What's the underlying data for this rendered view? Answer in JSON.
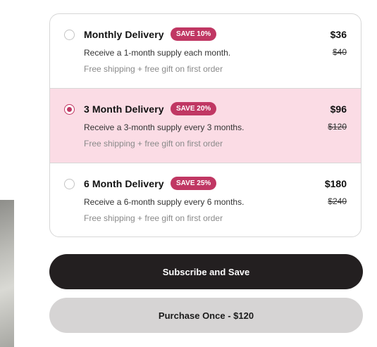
{
  "plans": [
    {
      "title": "Monthly Delivery",
      "badge": "SAVE 10%",
      "description": "Receive a 1-month supply each month.",
      "perk": "Free shipping + free gift on first order",
      "price": "$36",
      "old_price": "$40",
      "selected": false
    },
    {
      "title": "3 Month Delivery",
      "badge": "SAVE 20%",
      "description": "Receive a 3-month supply every 3 months.",
      "perk": "Free shipping + free gift on first order",
      "price": "$96",
      "old_price": "$120",
      "selected": true
    },
    {
      "title": "6 Month Delivery",
      "badge": "SAVE 25%",
      "description": "Receive a 6-month supply every 6 months.",
      "perk": "Free shipping + free gift on first order",
      "price": "$180",
      "old_price": "$240",
      "selected": false
    }
  ],
  "actions": {
    "subscribe_label": "Subscribe and Save",
    "purchase_once_label": "Purchase Once - $120"
  },
  "colors": {
    "accent": "#c03763",
    "selected_bg": "#fbdce5",
    "primary_button": "#231f20",
    "secondary_button": "#d6d4d4"
  },
  "icons": {
    "radio": "radio-button-icon"
  }
}
